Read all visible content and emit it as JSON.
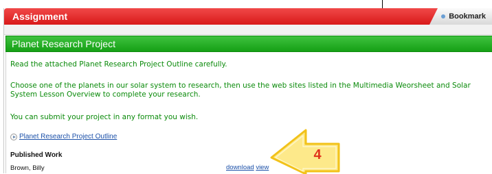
{
  "assignment_bar": {
    "title": "Assignment",
    "bookmark_label": "Bookmark"
  },
  "project": {
    "title": "Planet Research Project",
    "paragraphs": [
      "Read the attached Planet Research Project Outline carefully.",
      "Choose one of the planets in our solar system to research, then use the web sites listed in the Multimedia Weorsheet and Solar System Lesson Overview to complete your research.",
      "You can submit your project in any format you wish."
    ],
    "attachment_link": "Planet Research Project Outline"
  },
  "published_work": {
    "heading": "Published Work",
    "entries": [
      {
        "name": "Brown, Billy",
        "download_label": "download",
        "view_label": "view"
      }
    ]
  },
  "callout": {
    "number": "4",
    "fill_color": "#fde98a",
    "border_color": "#f2c21a",
    "text_color": "#e0331c"
  },
  "colors": {
    "assignment_bar": "#e42a2a",
    "project_bar": "#22a822",
    "body_text": "#0a8a0a",
    "link": "#1a4fa8"
  },
  "icons": {
    "bookmark": "bookmark-dot-icon",
    "attachment": "play-circle-icon",
    "callout": "arrow-callout-icon"
  }
}
